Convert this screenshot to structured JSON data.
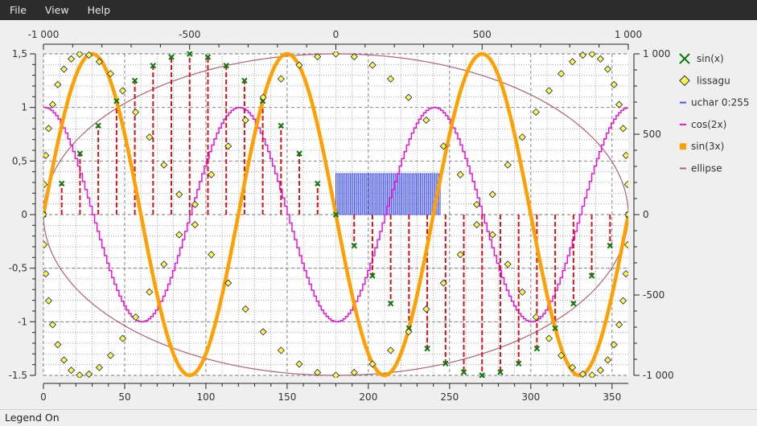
{
  "menu": {
    "file": "File",
    "view": "View",
    "help": "Help"
  },
  "status": {
    "text": "Legend On"
  },
  "chart_data": {
    "type": "line",
    "axes": {
      "bottom": {
        "range": [
          0,
          360
        ],
        "ticks": [
          0,
          50,
          100,
          150,
          200,
          250,
          300,
          350
        ],
        "labels": [
          "0",
          "50",
          "100",
          "150",
          "200",
          "250",
          "300",
          "350"
        ]
      },
      "left": {
        "range": [
          -1.5,
          1.5
        ],
        "ticks": [
          -1.5,
          -1,
          -0.5,
          0,
          0.5,
          1,
          1.5
        ],
        "labels": [
          "-1.5",
          "-1",
          "-0,5",
          "0",
          "0,5",
          "1",
          "1,5"
        ]
      },
      "top": {
        "range": [
          -1000,
          1000
        ],
        "ticks": [
          -1000,
          -500,
          0,
          500,
          1000
        ],
        "labels": [
          "-1 000",
          "-500",
          "0",
          "500",
          "1 000"
        ]
      },
      "right": {
        "range": [
          -1000,
          1000
        ],
        "ticks": [
          -1000,
          -500,
          0,
          500,
          1000
        ],
        "labels": [
          "-1 000",
          "-500",
          "0",
          "500",
          "1 000"
        ]
      }
    },
    "grid": true,
    "legend_position": "right",
    "series": [
      {
        "name": "sin(x)",
        "kind": "stem",
        "color": "#0a7a0a",
        "stem_color": "#dd1111",
        "x": [
          0,
          11.25,
          22.5,
          33.75,
          45,
          56.25,
          67.5,
          78.75,
          90,
          101.25,
          112.5,
          123.75,
          135,
          146.25,
          157.5,
          168.75,
          180,
          191.25,
          202.5,
          213.75,
          225,
          236.25,
          247.5,
          258.75,
          270,
          281.25,
          292.5,
          303.75,
          315,
          326.25,
          337.5,
          348.75,
          360
        ],
        "y": [
          0,
          0.29,
          0.57,
          0.83,
          1.06,
          1.25,
          1.39,
          1.47,
          1.5,
          1.47,
          1.39,
          1.25,
          1.06,
          0.83,
          0.57,
          0.29,
          0,
          -0.29,
          -0.57,
          -0.83,
          -1.06,
          -1.25,
          -1.39,
          -1.47,
          -1.5,
          -1.47,
          -1.39,
          -1.25,
          -1.06,
          -0.83,
          -0.57,
          -0.29,
          0
        ]
      },
      {
        "name": "lissagu",
        "kind": "scatter",
        "color": "#ffff33",
        "edge": "#1a1a7a",
        "param": {
          "x": "180-180*cos(t)",
          "y": "1.5*sin(3t)",
          "points": 100
        }
      },
      {
        "name": "uchar 0:255",
        "kind": "square-wave",
        "color": "#4455ee",
        "axis": "right",
        "x_range": [
          180,
          245
        ],
        "values": [
          0,
          255
        ],
        "cycles": 40
      },
      {
        "name": "cos(2x)",
        "kind": "line",
        "color": "#ee11dd",
        "amplitude": 1,
        "frequency": 3,
        "fn": "cos"
      },
      {
        "name": "sin(3x)",
        "kind": "line",
        "color": "#ffa000",
        "amplitude": 1.5,
        "frequency": 3,
        "fn": "sin"
      },
      {
        "name": "ellipse",
        "kind": "line",
        "color": "#b06070",
        "axis": "top-right",
        "center": [
          0,
          0
        ],
        "radius": [
          1000,
          1000
        ]
      }
    ]
  }
}
